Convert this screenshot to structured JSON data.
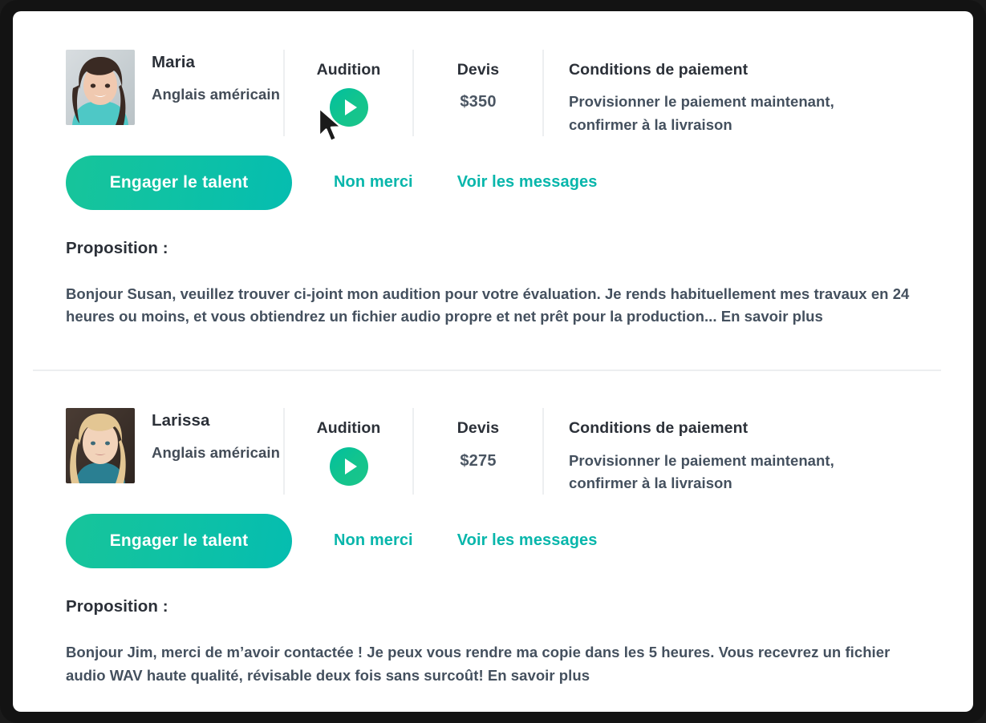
{
  "theme": {
    "accent_teal": "#07b6ab",
    "gradient_green_start": "#17c49a",
    "gradient_green_end": "#05bdb0",
    "text_dark": "#2b3038",
    "text_body": "#44505e",
    "divider": "#eceef0"
  },
  "columns": {
    "audition_label": "Audition",
    "quote_label": "Devis",
    "terms_label": "Conditions de paiement",
    "terms_body": "Provisionner le paiement maintenant, confirmer à la livraison"
  },
  "actions": {
    "hire_label": "Engager le talent",
    "decline_label": "Non merci",
    "messages_label": "Voir les messages"
  },
  "proposal": {
    "label": "Proposition :"
  },
  "icons": {
    "play": "play-icon",
    "cursor": "mouse-pointer-icon"
  },
  "cards": [
    {
      "name": "Maria",
      "language": "Anglais américain",
      "quote": "$350",
      "proposal_text": "Bonjour Susan, veuillez trouver ci-joint mon audition pour votre évaluation. Je rends habituellement mes travaux en 24 heures ou moins, et vous obtiendrez un fichier audio propre et net prêt pour la production...",
      "proposal_more": " En savoir plus",
      "cursor_visible": true
    },
    {
      "name": "Larissa",
      "language": "Anglais américain",
      "quote": "$275",
      "proposal_text": "Bonjour Jim, merci de m’avoir contactée ! Je peux vous rendre ma copie dans les 5 heures. Vous recevrez un fichier audio WAV haute qualité, révisable deux fois sans surcoût!",
      "proposal_more": " En savoir plus",
      "cursor_visible": false
    }
  ]
}
